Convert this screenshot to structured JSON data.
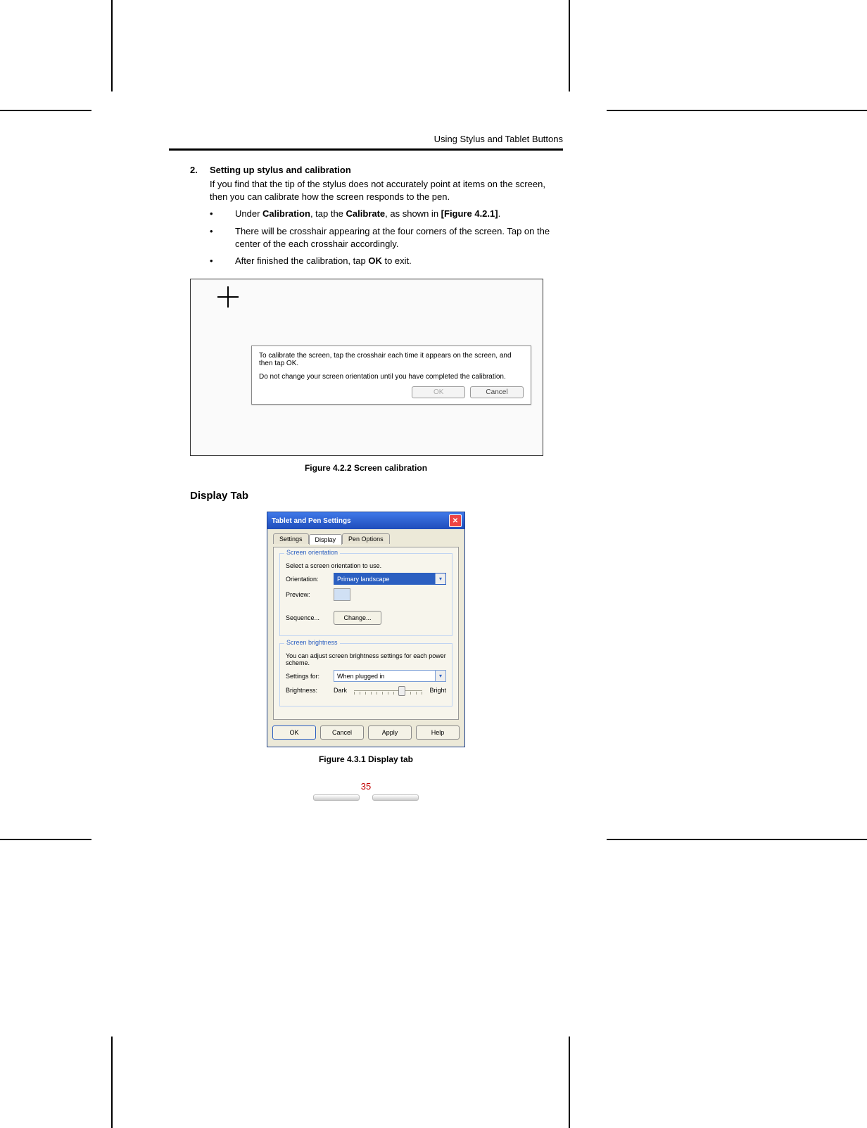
{
  "header": {
    "section": "Using Stylus and Tablet Buttons"
  },
  "step": {
    "number": "2.",
    "title": "Setting up stylus and calibration",
    "intro": "If you find that the tip of the stylus does not accurately point at items on the screen, then you can calibrate how the screen responds to the pen.",
    "bullets": [
      {
        "pre": "Under ",
        "b1": "Calibration",
        "mid1": ", tap the ",
        "b2": "Calibrate",
        "mid2": ", as shown in ",
        "b3": "[Figure 4.2.1]",
        "post": "."
      },
      {
        "text": "There will be crosshair appearing at the four corners of the screen. Tap on the center of the each crosshair accordingly."
      },
      {
        "pre": "After finished the calibration, tap ",
        "b1": "OK",
        "post": " to exit."
      }
    ]
  },
  "calibration_dialog": {
    "line1": "To calibrate the screen, tap the crosshair each time it appears on the screen, and then tap OK.",
    "line2": "Do not change your screen orientation until you have completed the calibration.",
    "ok": "OK",
    "cancel": "Cancel"
  },
  "figure1_caption": "Figure 4.2.2 Screen calibration",
  "display_tab_heading": "Display Tab",
  "xp": {
    "title": "Tablet and Pen Settings",
    "tabs": [
      "Settings",
      "Display",
      "Pen Options"
    ],
    "active_tab": 1,
    "grp1": {
      "title": "Screen orientation",
      "desc": "Select a screen orientation to use.",
      "orientation_label": "Orientation:",
      "orientation_value": "Primary landscape",
      "preview_label": "Preview:",
      "sequence_label": "Sequence...",
      "change_btn": "Change..."
    },
    "grp2": {
      "title": "Screen brightness",
      "desc": "You can adjust screen brightness settings for each power scheme.",
      "settings_for_label": "Settings for:",
      "settings_for_value": "When plugged in",
      "brightness_label": "Brightness:",
      "dark": "Dark",
      "bright": "Bright"
    },
    "buttons": {
      "ok": "OK",
      "cancel": "Cancel",
      "apply": "Apply",
      "help": "Help"
    }
  },
  "figure2_caption": "Figure 4.3.1 Display tab",
  "page_number": "35"
}
